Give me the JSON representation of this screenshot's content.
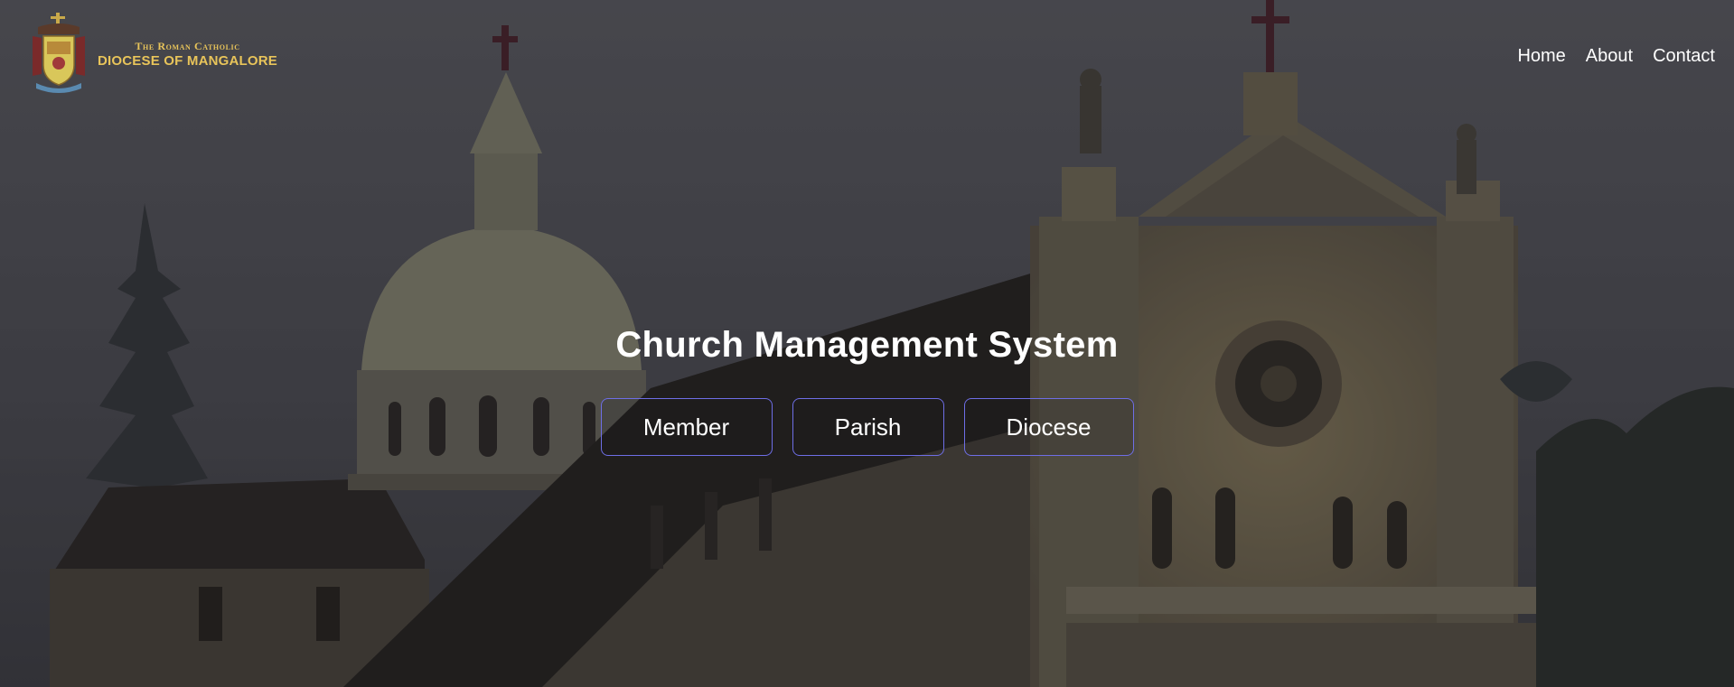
{
  "header": {
    "logo": {
      "line1": "The Roman Catholic",
      "line2": "DIOCESE OF MANGALORE",
      "icon": "diocese-crest-icon"
    },
    "nav": {
      "home": "Home",
      "about": "About",
      "contact": "Contact"
    }
  },
  "hero": {
    "title": "Church Management System",
    "buttons": {
      "member": "Member",
      "parish": "Parish",
      "diocese": "Diocese"
    },
    "background": "church-photo"
  },
  "colors": {
    "logo_gold": "#e8c45a",
    "button_border": "#6e6ee6",
    "text": "#ffffff"
  }
}
